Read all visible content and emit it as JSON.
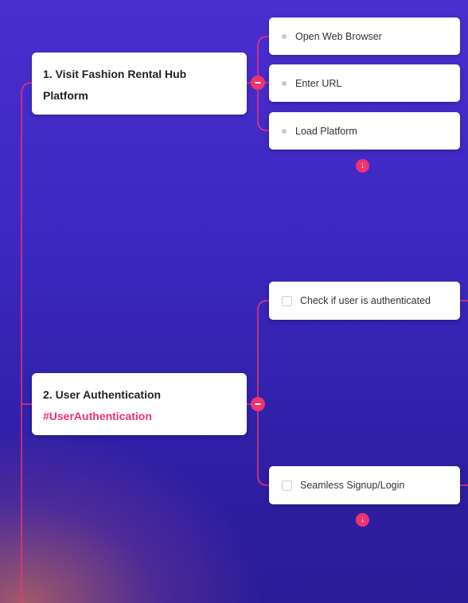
{
  "nodes": [
    {
      "title_line1": "1. Visit Fashion Rental Hub",
      "title_line2": "Platform",
      "children": [
        {
          "label": "Open Web Browser"
        },
        {
          "label": "Enter URL"
        },
        {
          "label": "Load Platform"
        }
      ]
    },
    {
      "title": "2. User Authentication",
      "tag": "#UserAuthentication",
      "children": [
        {
          "label": "Check if user is authenticated"
        },
        {
          "label": "Seamless Signup/Login"
        }
      ]
    }
  ],
  "colors": {
    "accent": "#f0326d",
    "background_top": "#4a2ed0",
    "background_bottom": "#2a1c98"
  },
  "icons": {
    "collapse": "minus-icon",
    "expand_more": "arrow-down-icon"
  },
  "glyphs": {
    "arrow_down": "↓"
  }
}
